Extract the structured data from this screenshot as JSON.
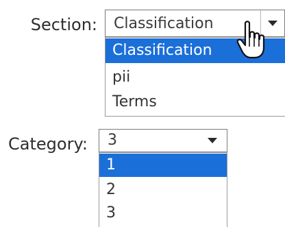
{
  "section": {
    "label": "Section:",
    "selected_value": "Classification",
    "options": [
      "Classification",
      "pii",
      "Terms"
    ],
    "highlighted_index": 0,
    "expanded": true
  },
  "category": {
    "label": "Category:",
    "selected_value": "3",
    "options": [
      "1",
      "2",
      "3"
    ],
    "highlighted_index": 0,
    "expanded": true
  },
  "icons": {
    "dropdown_arrow": "chevron-down-icon",
    "cursor": "hand-pointer-icon"
  },
  "colors": {
    "highlight": "#1b6fd9",
    "highlight_text": "#ffffff",
    "text": "#333333",
    "border": "#7a7a7a"
  }
}
